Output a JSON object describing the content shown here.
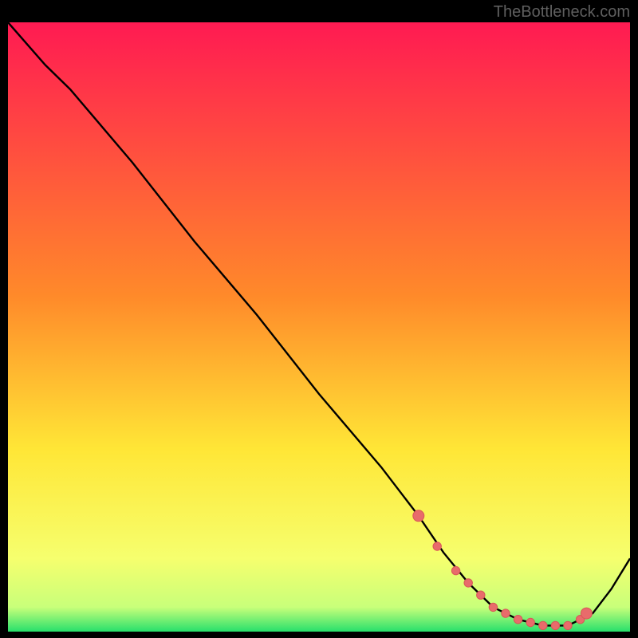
{
  "watermark": "TheBottleneck.com",
  "colors": {
    "bg": "#000000",
    "curve": "#000000",
    "marker_fill": "#e86b6b",
    "marker_stroke": "#d95757",
    "grad_top": "#ff1a52",
    "grad_mid1": "#ff8a2a",
    "grad_mid2": "#ffe636",
    "grad_low": "#f6ff6e",
    "grad_green": "#28e06c"
  },
  "chart_data": {
    "type": "line",
    "title": "",
    "xlabel": "",
    "ylabel": "",
    "xlim": [
      0,
      100
    ],
    "ylim": [
      0,
      100
    ],
    "series": [
      {
        "name": "bottleneck-curve",
        "x": [
          0,
          6,
          10,
          20,
          30,
          40,
          50,
          60,
          66,
          70,
          74,
          78,
          82,
          86,
          90,
          94,
          97,
          100
        ],
        "y": [
          100,
          93,
          89,
          77,
          64,
          52,
          39,
          27,
          19,
          13,
          8,
          4,
          2,
          1,
          1,
          3,
          7,
          12
        ]
      }
    ],
    "markers": {
      "name": "highlighted-points",
      "x": [
        66,
        69,
        72,
        74,
        76,
        78,
        80,
        82,
        84,
        86,
        88,
        90,
        92,
        93
      ],
      "y": [
        19,
        14,
        10,
        8,
        6,
        4,
        3,
        2,
        1.5,
        1,
        1,
        1,
        2,
        3
      ]
    }
  }
}
